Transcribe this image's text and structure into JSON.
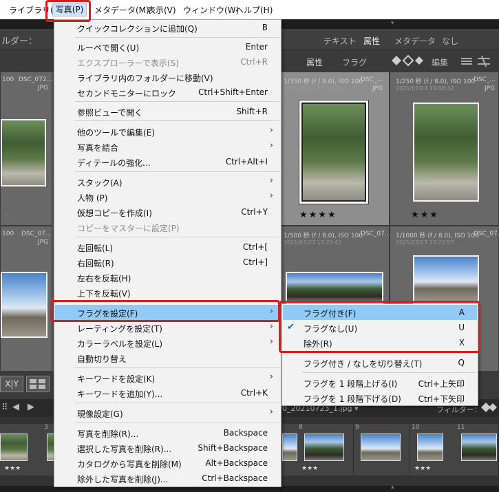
{
  "menubar": {
    "items": [
      "ライブラリ(L)",
      "写真(P)",
      "メタデータ(M)",
      "表示(V)",
      "ウィンドウ(W)",
      "ヘルプ(H)"
    ]
  },
  "library": {
    "folder_label": "ルダー：",
    "filter_tabs": [
      "テキスト",
      "属性",
      "メタデータ",
      "なし"
    ],
    "attr_label": "属性",
    "flag_label": "フラグ",
    "edit_label": "編集",
    "cells": [
      {
        "meta": "100",
        "name": "DSC_072...",
        "type": "JPG",
        "date": ""
      },
      {
        "meta": "",
        "name": "",
        "type": "",
        "date": ""
      },
      {
        "meta": "1/350 秒 (f / 8.0), ISO 100",
        "name": "DSC_...",
        "type": "JPG",
        "date": "2021/07/23 13:08:30"
      },
      {
        "meta": "1/250 秒 (f / 8.0), ISO 100",
        "name": "DSC_...",
        "type": "JPG",
        "date": "2021/07/23 13:08:32"
      },
      {
        "meta": "",
        "name": "",
        "type": "",
        "date": ""
      },
      {
        "meta": "100",
        "name": "DSC_07...",
        "type": "JPG",
        "date": ""
      },
      {
        "meta": "",
        "name": "",
        "type": "",
        "date": ""
      },
      {
        "meta": "1/500 秒 (f / 8.0), ISO 100",
        "name": "DSC_07...",
        "type": "JPG",
        "date": "2021/07/23 13:22:41"
      },
      {
        "meta": "1/1000 秒 (f / 8.0), ISO 100",
        "name": "DSC_07...",
        "type": "JPG",
        "date": "2021/07/23 13:22:57"
      },
      {
        "meta": "",
        "name": "",
        "type": "",
        "date": ""
      }
    ],
    "stars_a": "★★★★",
    "stars_b": "★★★",
    "filmstrip_path": "0_20210723_1.jpg ▾",
    "filter_label": "フィルター：",
    "film_numbers": [
      "3",
      "",
      "8",
      "9",
      "10",
      "11"
    ],
    "film_stars": "★★★"
  },
  "photo_menu": {
    "items": [
      {
        "label": "クイックコレクションに追加(Q)",
        "shortcut": "B"
      },
      {
        "label": "ルーペで開く(U)",
        "shortcut": "Enter"
      },
      {
        "label": "エクスプローラーで表示(S)",
        "shortcut": "Ctrl+R",
        "disabled": true
      },
      {
        "label": "ライブラリ内のフォルダーに移動(V)",
        "shortcut": ""
      },
      {
        "label": "セカンドモニターにロック",
        "shortcut": "Ctrl+Shift+Enter"
      },
      {
        "label": "参照ビューで開く",
        "shortcut": "Shift+R"
      },
      {
        "label": "他のツールで編集(E)",
        "shortcut": "",
        "submenu": true
      },
      {
        "label": "写真を結合",
        "shortcut": "",
        "submenu": true
      },
      {
        "label": "ディテールの強化...",
        "shortcut": "Ctrl+Alt+I"
      },
      {
        "label": "スタック(A)",
        "shortcut": "",
        "submenu": true
      },
      {
        "label": "人物 (P)",
        "shortcut": "",
        "submenu": true
      },
      {
        "label": "仮想コピーを作成(I)",
        "shortcut": "Ctrl+Y"
      },
      {
        "label": "コピーをマスターに設定(P)",
        "shortcut": "",
        "disabled": true
      },
      {
        "label": "左回転(L)",
        "shortcut": "Ctrl+["
      },
      {
        "label": "右回転(R)",
        "shortcut": "Ctrl+]"
      },
      {
        "label": "左右を反転(H)",
        "shortcut": ""
      },
      {
        "label": "上下を反転(V)",
        "shortcut": ""
      },
      {
        "label": "フラグを設定(F)",
        "shortcut": "",
        "submenu": true,
        "highlighted": true
      },
      {
        "label": "レーティングを設定(T)",
        "shortcut": "",
        "submenu": true
      },
      {
        "label": "カラーラベルを設定(L)",
        "shortcut": "",
        "submenu": true
      },
      {
        "label": "自動切り替え",
        "shortcut": ""
      },
      {
        "label": "キーワードを設定(K)",
        "shortcut": "",
        "submenu": true
      },
      {
        "label": "キーワードを追加(Y)...",
        "shortcut": "Ctrl+K"
      },
      {
        "label": "現像設定(G)",
        "shortcut": "",
        "submenu": true
      },
      {
        "label": "写真を削除(R)...",
        "shortcut": "Backspace"
      },
      {
        "label": "選択した写真を削除(R)...",
        "shortcut": "Shift+Backspace"
      },
      {
        "label": "カタログから写真を削除(M)",
        "shortcut": "Alt+Backspace"
      },
      {
        "label": "除外した写真を削除(J)...",
        "shortcut": "Ctrl+Backspace"
      }
    ]
  },
  "flag_submenu": {
    "items": [
      {
        "label": "フラグ付き(F)",
        "shortcut": "A",
        "highlighted": true
      },
      {
        "label": "フラグなし(U)",
        "shortcut": "U",
        "checked": true
      },
      {
        "label": "除外(R)",
        "shortcut": "X"
      },
      {
        "label": "フラグ付き / なしを切り替え(T)",
        "shortcut": "Q"
      },
      {
        "label": "フラグを 1 段階上げる(I)",
        "shortcut": "Ctrl+上矢印"
      },
      {
        "label": "フラグを 1 段階下げる(D)",
        "shortcut": "Ctrl+下矢印"
      }
    ]
  },
  "colors": {
    "highlight": "#91c9f7",
    "callout": "#e0191b",
    "menu_bg": "#f2f2f2"
  }
}
